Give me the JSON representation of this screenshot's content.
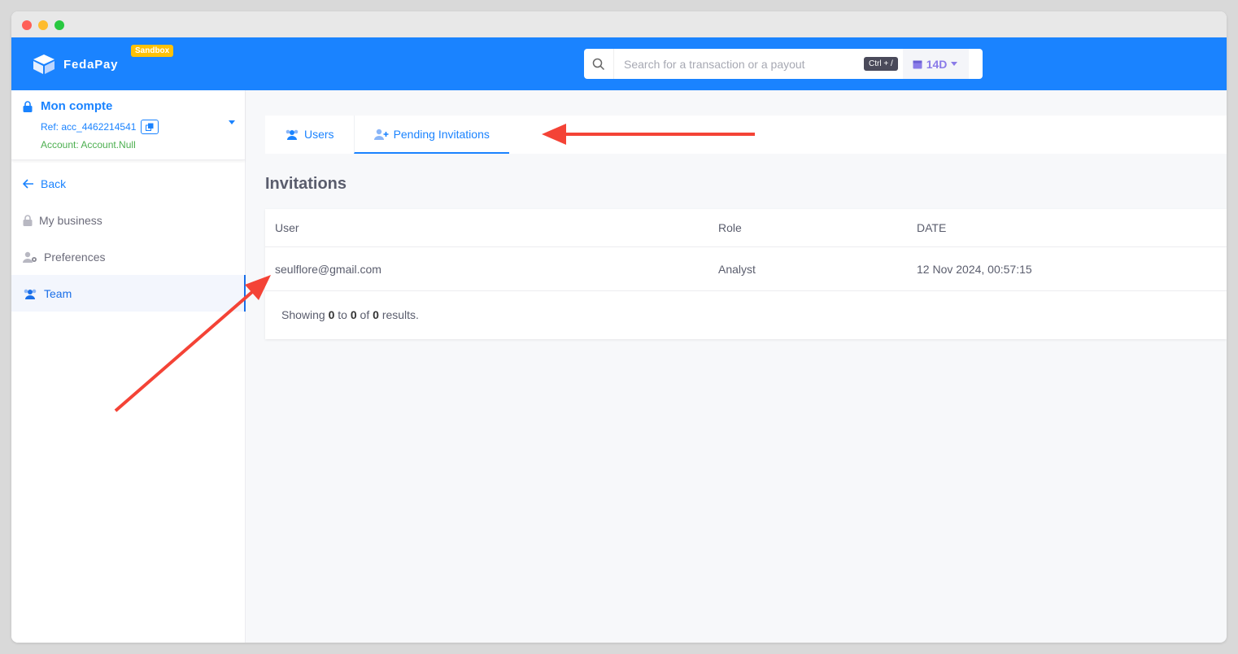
{
  "brand": {
    "name": "FedaPay",
    "badge": "Sandbox"
  },
  "search": {
    "placeholder": "Search for a transaction or a payout",
    "shortcut": "Ctrl + /",
    "period": "14D"
  },
  "account": {
    "title": "Mon compte",
    "ref": "Ref: acc_4462214541",
    "name": "Account: Account.Null"
  },
  "sidebar": {
    "items": [
      {
        "label": "Back",
        "icon": "arrow-left-icon"
      },
      {
        "label": "My business",
        "icon": "lock-icon"
      },
      {
        "label": "Preferences",
        "icon": "user-gear-icon"
      },
      {
        "label": "Team",
        "icon": "users-icon",
        "active": true
      }
    ]
  },
  "tabs": [
    {
      "label": "Users",
      "icon": "users-icon"
    },
    {
      "label": "Pending Invitations",
      "icon": "user-plus-icon",
      "active": true
    }
  ],
  "page": {
    "title": "Invitations"
  },
  "table": {
    "headers": [
      "User",
      "Role",
      "DATE"
    ],
    "rows": [
      [
        "seulflore@gmail.com",
        "Analyst",
        "12 Nov 2024, 00:57:15"
      ]
    ]
  },
  "pagination": {
    "prefix": "Showing",
    "from": "0",
    "to_word": "to",
    "to": "0",
    "of_word": "of",
    "total": "0",
    "suffix": "results."
  },
  "colors": {
    "brand": "#1a83ff",
    "badge": "#ffc107",
    "annotation": "#f44336",
    "success": "#4caf50"
  }
}
